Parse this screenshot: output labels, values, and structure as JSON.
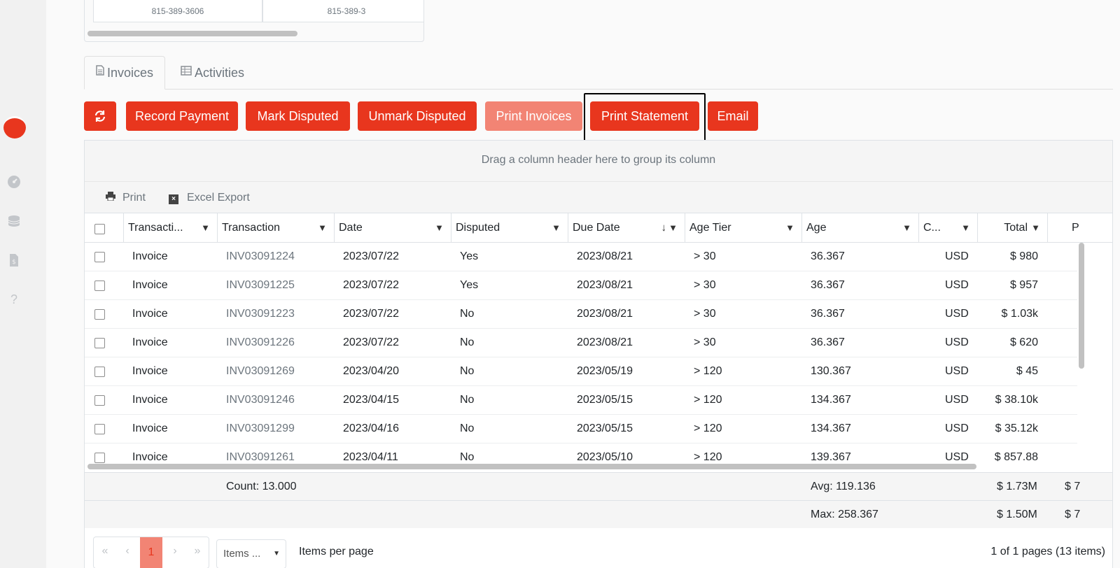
{
  "sidebar": {
    "icons": [
      "dashboard-icon",
      "coins-icon",
      "invoice-dollar-icon",
      "help-icon"
    ],
    "help_glyph": "?"
  },
  "contact_card": {
    "cells": [
      "815-389-3606",
      "815-389-3"
    ]
  },
  "tabs": [
    {
      "label": "Invoices",
      "icon": "file-icon",
      "active": true
    },
    {
      "label": "Activities",
      "icon": "table-icon",
      "active": false
    }
  ],
  "actions": {
    "refresh_icon": "refresh-icon",
    "record_payment": "Record Payment",
    "mark_disputed": "Mark Disputed",
    "unmark_disputed": "Unmark Disputed",
    "print_invoices": "Print Invoices",
    "print_statement": "Print Statement",
    "email": "Email"
  },
  "grid": {
    "group_panel": "Drag a column header here to group its column",
    "toolbar": {
      "print": "Print",
      "excel_export": "Excel Export"
    },
    "columns": [
      "Transacti...",
      "Transaction",
      "Date",
      "Disputed",
      "Due Date",
      "Age Tier",
      "Age",
      "C...",
      "Total",
      "P"
    ],
    "rows": [
      {
        "type": "Invoice",
        "number": "INV03091224",
        "date": "2023/07/22",
        "disputed": "Yes",
        "due": "2023/08/21",
        "tier": "> 30",
        "age": "36.367",
        "currency": "USD",
        "total": "$ 980"
      },
      {
        "type": "Invoice",
        "number": "INV03091225",
        "date": "2023/07/22",
        "disputed": "Yes",
        "due": "2023/08/21",
        "tier": "> 30",
        "age": "36.367",
        "currency": "USD",
        "total": "$ 957"
      },
      {
        "type": "Invoice",
        "number": "INV03091223",
        "date": "2023/07/22",
        "disputed": "No",
        "due": "2023/08/21",
        "tier": "> 30",
        "age": "36.367",
        "currency": "USD",
        "total": "$ 1.03k"
      },
      {
        "type": "Invoice",
        "number": "INV03091226",
        "date": "2023/07/22",
        "disputed": "No",
        "due": "2023/08/21",
        "tier": "> 30",
        "age": "36.367",
        "currency": "USD",
        "total": "$ 620"
      },
      {
        "type": "Invoice",
        "number": "INV03091269",
        "date": "2023/04/20",
        "disputed": "No",
        "due": "2023/05/19",
        "tier": "> 120",
        "age": "130.367",
        "currency": "USD",
        "total": "$ 45"
      },
      {
        "type": "Invoice",
        "number": "INV03091246",
        "date": "2023/04/15",
        "disputed": "No",
        "due": "2023/05/15",
        "tier": "> 120",
        "age": "134.367",
        "currency": "USD",
        "total": "$ 38.10k"
      },
      {
        "type": "Invoice",
        "number": "INV03091299",
        "date": "2023/04/16",
        "disputed": "No",
        "due": "2023/05/15",
        "tier": "> 120",
        "age": "134.367",
        "currency": "USD",
        "total": "$ 35.12k"
      },
      {
        "type": "Invoice",
        "number": "INV03091261",
        "date": "2023/04/11",
        "disputed": "No",
        "due": "2023/05/10",
        "tier": "> 120",
        "age": "139.367",
        "currency": "USD",
        "total": "$ 857.88"
      }
    ],
    "footer": {
      "count": "Count: 13.000",
      "avg": "Avg: 119.136",
      "total_sum": "$ 1.73M",
      "next_col_sum": "$ 7",
      "max": "Max: 258.367",
      "total_max": "$ 1.50M",
      "next_col_max": "$ 7"
    },
    "pager": {
      "first": "«",
      "prev": "‹",
      "current_page": "1",
      "next": "›",
      "last": "»",
      "items_select": "Items ...",
      "items_per_page": "Items per page",
      "info": "1 of 1 pages (13 items)"
    }
  },
  "colors": {
    "accent": "#e8361e",
    "accent_light": "#f28474"
  }
}
